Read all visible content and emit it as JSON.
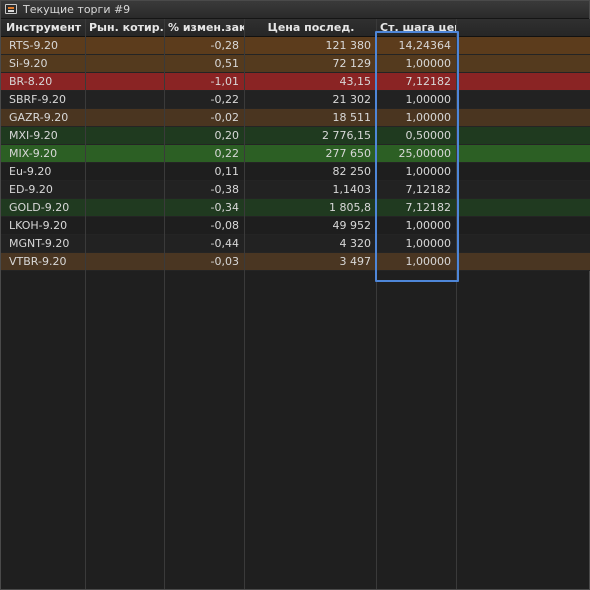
{
  "window": {
    "title": "Текущие торги #9"
  },
  "table": {
    "columns": [
      "Инструмент со",
      "Рын. котир.",
      "% измен.закр.",
      "Цена послед.",
      "Ст. шага цены"
    ],
    "rows": [
      {
        "instrument": "RTS-9.20",
        "change": "-0,28",
        "price": "121 380",
        "step": "14,24364",
        "color": "#5c3c1c"
      },
      {
        "instrument": "Si-9.20",
        "change": "0,51",
        "price": "72 129",
        "step": "1,00000",
        "color": "#543a1e"
      },
      {
        "instrument": "BR-8.20",
        "change": "-1,01",
        "price": "43,15",
        "step": "7,12182",
        "color": "#8a2424"
      },
      {
        "instrument": "SBRF-9.20",
        "change": "-0,22",
        "price": "21 302",
        "step": "1,00000",
        "color": "#222222"
      },
      {
        "instrument": "GAZR-9.20",
        "change": "-0,02",
        "price": "18 511",
        "step": "1,00000",
        "color": "#4a3520"
      },
      {
        "instrument": "MXI-9.20",
        "change": "0,20",
        "price": "2 776,15",
        "step": "0,50000",
        "color": "#1f3a1f"
      },
      {
        "instrument": "MIX-9.20",
        "change": "0,22",
        "price": "277 650",
        "step": "25,00000",
        "color": "#2c5f24"
      },
      {
        "instrument": "Eu-9.20",
        "change": "0,11",
        "price": "82 250",
        "step": "1,00000",
        "color": "#1e1e1e"
      },
      {
        "instrument": "ED-9.20",
        "change": "-0,38",
        "price": "1,1403",
        "step": "7,12182",
        "color": "#222222"
      },
      {
        "instrument": "GOLD-9.20",
        "change": "-0,34",
        "price": "1 805,8",
        "step": "7,12182",
        "color": "#203a20"
      },
      {
        "instrument": "LKOH-9.20",
        "change": "-0,08",
        "price": "49 952",
        "step": "1,00000",
        "color": "#1e1e1e"
      },
      {
        "instrument": "MGNT-9.20",
        "change": "-0,44",
        "price": "4 320",
        "step": "1,00000",
        "color": "#222222"
      },
      {
        "instrument": "VTBR-9.20",
        "change": "-0,03",
        "price": "3 497",
        "step": "1,00000",
        "color": "#4a3622"
      }
    ]
  },
  "accents": {
    "highlight_border": "#4e86d8"
  }
}
